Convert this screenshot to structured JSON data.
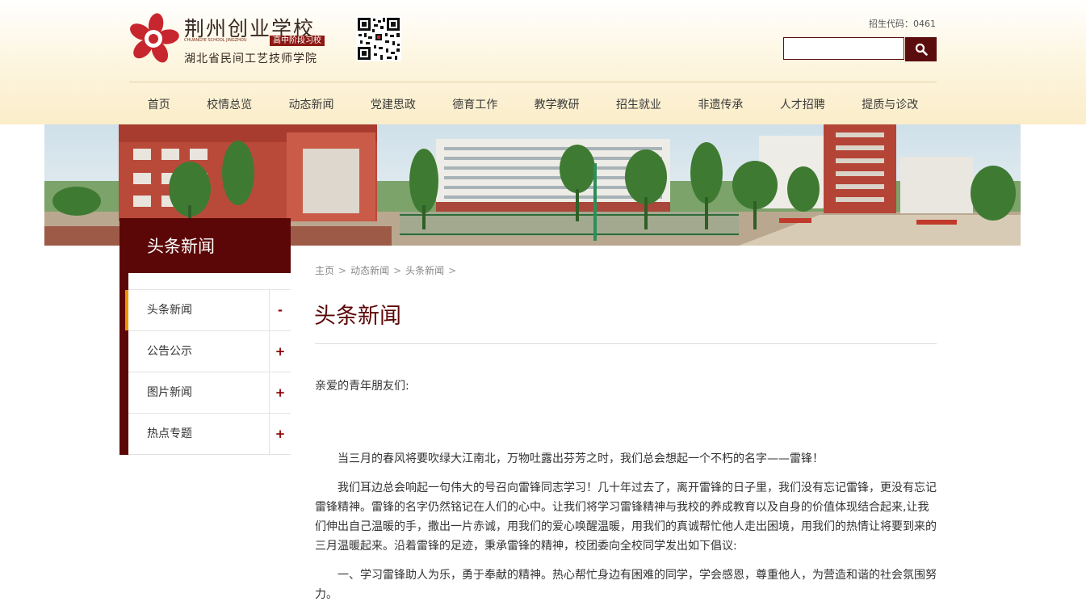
{
  "header": {
    "school_name": "荆州创业学校",
    "school_name_en": "CHUANGYE SCHOOL JINGZHOU",
    "school_tag": "高中阶段习校",
    "school_subtitle": "湖北省民间工艺技师学院",
    "enroll_code": "招生代码：0461",
    "search_placeholder": ""
  },
  "nav": {
    "items": [
      "首页",
      "校情总览",
      "动态新闻",
      "党建思政",
      "德育工作",
      "教学教研",
      "招生就业",
      "非遗传承",
      "人才招聘",
      "提质与诊改"
    ]
  },
  "sidebar": {
    "title": "头条新闻",
    "items": [
      {
        "label": "头条新闻",
        "sign": "-"
      },
      {
        "label": "公告公示",
        "sign": "+"
      },
      {
        "label": "图片新闻",
        "sign": "+"
      },
      {
        "label": "热点专题",
        "sign": "+"
      }
    ]
  },
  "breadcrumb": {
    "items": [
      "主页",
      "动态新闻",
      "头条新闻"
    ],
    "separator": ">"
  },
  "content": {
    "title": "头条新闻",
    "greeting": "亲爱的青年朋友们:",
    "paragraphs": [
      "当三月的春风将要吹绿大江南北，万物吐露出芬芳之时，我们总会想起一个不朽的名字——雷锋！",
      "我们耳边总会响起一句伟大的号召向雷锋同志学习！几十年过去了，离开雷锋的日子里，我们没有忘记雷锋，更没有忘记雷锋精神。雷锋的名字仍然铭记在人们的心中。让我们将学习雷锋精神与我校的养成教育以及自身的价值体现结合起来,让我们伸出自己温暖的手，撒出一片赤诚，用我们的爱心唤醒温暖，用我们的真诚帮忙他人走出困境，用我们的热情让将要到来的三月温暖起来。沿着雷锋的足迹，秉承雷锋的精神，校团委向全校同学发出如下倡议:",
      "一、学习雷锋助人为乐，勇于奉献的精神。热心帮忙身边有困难的同学，学会感恩，尊重他人，为营造和谐的社会氛围努力。"
    ]
  },
  "colors": {
    "brand_dark_red": "#5c0707",
    "accent_orange": "#ef9300",
    "header_cream": "#fbedc9"
  }
}
